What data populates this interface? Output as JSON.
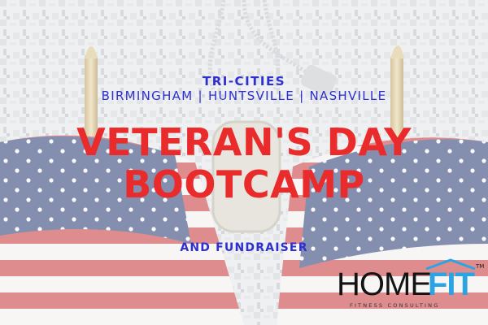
{
  "headline": {
    "tri_cities": "TRI-CITIES",
    "cities": "BIRMINGHAM | HUNTSVILLE | NASHVILLE",
    "title_line1": "VETERAN'S DAY",
    "title_line2": "BOOTCAMP",
    "subtitle": "AND FUNDRAISER"
  },
  "logo": {
    "home": "HOME",
    "fit": "FIT",
    "trademark": "TM",
    "tagline": "FITNESS CONSULTING"
  },
  "colors": {
    "headline_red": "#ea2b2b",
    "city_blue": "#2e2fd0",
    "fit_blue": "#2aa4e3",
    "flag_red": "#c93a3f",
    "flag_blue": "#2c3e78",
    "camo_light": "#e6e7ea",
    "camo_mid": "#c8cace"
  },
  "icons": {
    "left_flag": "american-flag-icon",
    "right_flag": "american-flag-icon",
    "dog_tags": "dog-tag-icon",
    "logo_roof": "house-roof-icon"
  }
}
